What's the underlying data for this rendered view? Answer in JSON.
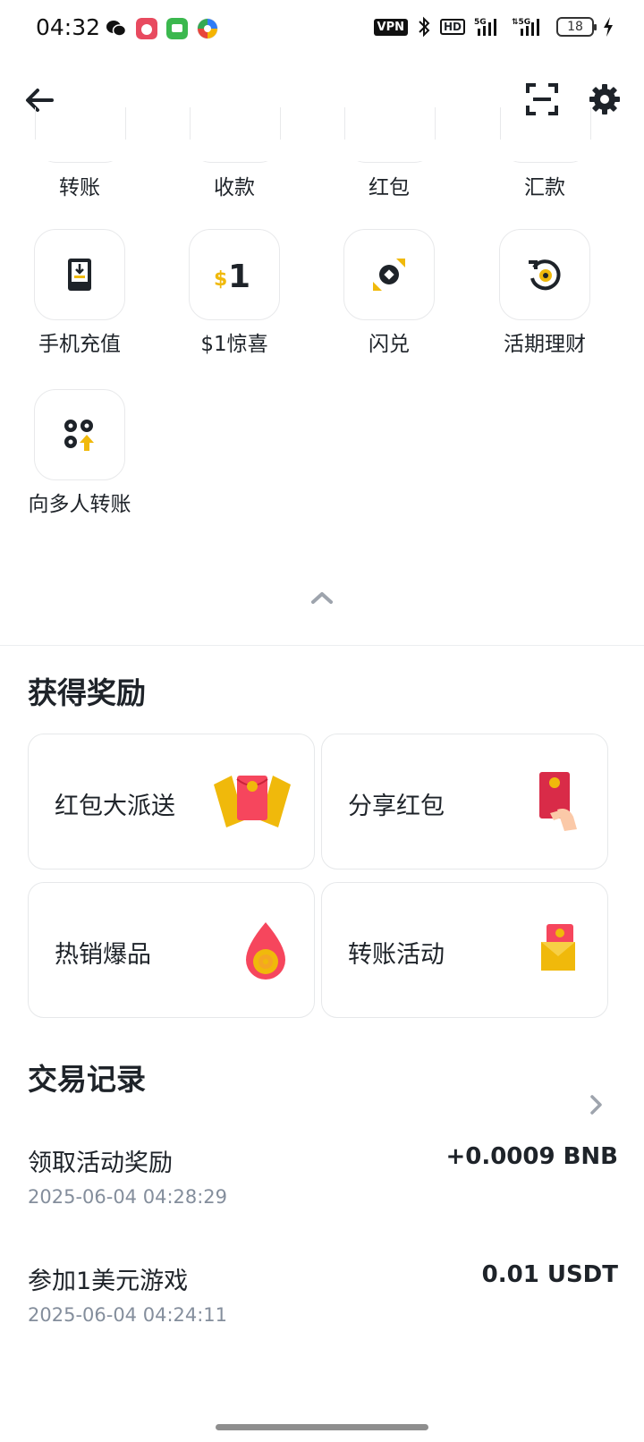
{
  "status_bar": {
    "time": "04:32",
    "vpn": "VPN",
    "hd": "HD",
    "battery": "18"
  },
  "header": {
    "back_icon": "arrow-left-icon",
    "scan_icon": "scan-icon",
    "settings_icon": "gear-icon"
  },
  "tools_partial": [
    {
      "label": "转账"
    },
    {
      "label": "收款"
    },
    {
      "label": "红包"
    },
    {
      "label": "汇款"
    }
  ],
  "tools": [
    {
      "label": "手机充值",
      "icon": "phone-topup-icon"
    },
    {
      "label": "$1惊喜",
      "icon": "dollar-one-icon"
    },
    {
      "label": "闪兑",
      "icon": "convert-icon"
    },
    {
      "label": "活期理财",
      "icon": "flexible-earn-icon"
    },
    {
      "label": "向多人转账",
      "icon": "batch-transfer-icon"
    }
  ],
  "rewards": {
    "title": "获得奖励",
    "cards": [
      {
        "label": "红包大派送",
        "icon": "red-envelopes-icon"
      },
      {
        "label": "分享红包",
        "icon": "share-red-envelope-icon"
      },
      {
        "label": "热销爆品",
        "icon": "hot-flame-icon"
      },
      {
        "label": "转账活动",
        "icon": "transfer-envelope-icon"
      }
    ]
  },
  "transactions": {
    "title": "交易记录",
    "items": [
      {
        "title": "领取活动奖励",
        "time": "2025-06-04 04:28:29",
        "amount": "+0.0009 BNB"
      },
      {
        "title": "参加1美元游戏",
        "time": "2025-06-04 04:24:11",
        "amount": "0.01 USDT"
      }
    ]
  },
  "colors": {
    "accent": "#f0b90b",
    "red": "#f6465d",
    "text": "#1e2329",
    "muted": "#848e9c"
  }
}
